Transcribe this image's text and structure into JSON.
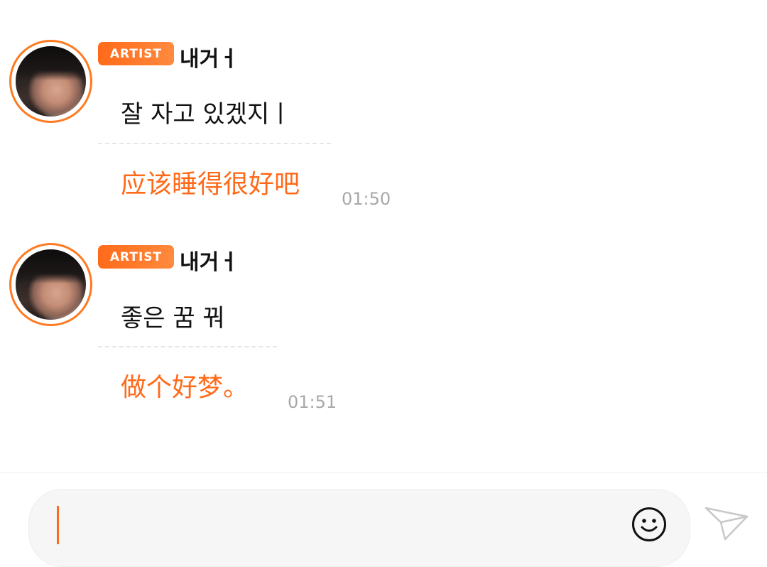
{
  "messages": [
    {
      "badge": "ARTIST",
      "author": "내거ㅓ",
      "text_korean": "잘 자고 있겠지ㅣ",
      "translation": "应该睡得很好吧",
      "time": "01:50"
    },
    {
      "badge": "ARTIST",
      "author": "내거ㅓ",
      "text_korean": "좋은 꿈 꿔",
      "translation": "做个好梦。",
      "time": "01:51"
    }
  ],
  "composer": {
    "input_value": "",
    "emoji_icon": "smiley-face-icon",
    "send_icon": "paper-plane-icon"
  },
  "colors": {
    "accent": "#ff6a1a",
    "timestamp": "#a8a8a8",
    "text": "#111111"
  }
}
